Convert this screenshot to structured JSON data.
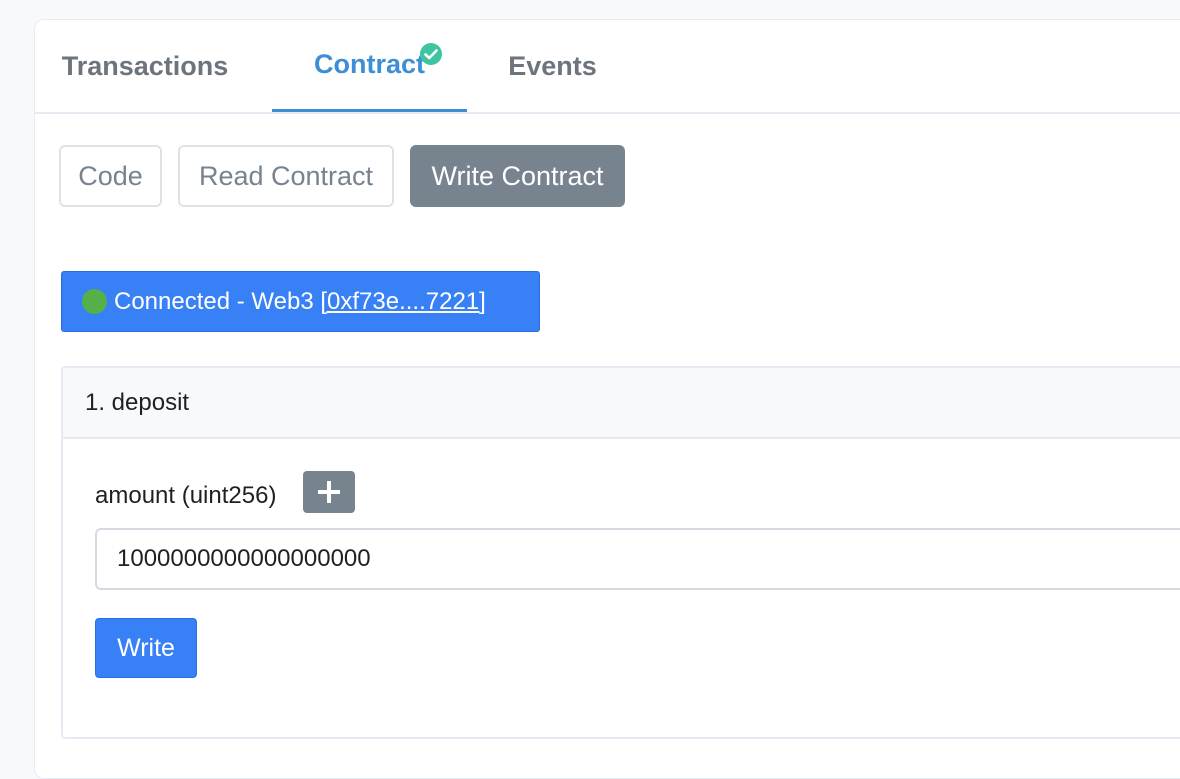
{
  "tabs": {
    "transactions": "Transactions",
    "contract": "Contract",
    "events": "Events",
    "active": "contract",
    "contract_verified_icon": "check-circle-icon"
  },
  "subtabs": {
    "code": "Code",
    "read_contract": "Read Contract",
    "write_contract": "Write Contract",
    "active": "write_contract"
  },
  "connection": {
    "status_icon": "green-dot-icon",
    "label": "Connected - Web3 ",
    "address": "[0xf73e....7221]"
  },
  "functions": [
    {
      "title": "1. deposit",
      "param_label": "amount (uint256)",
      "add_icon": "plus-icon",
      "input_value": "1000000000000000000",
      "button_label": "Write"
    }
  ],
  "colors": {
    "accent_blue": "#3880f5",
    "tab_active": "#3c8fd6",
    "verified_green": "#3ec4a0",
    "status_green": "#55b04a",
    "secondary": "#77838f"
  }
}
